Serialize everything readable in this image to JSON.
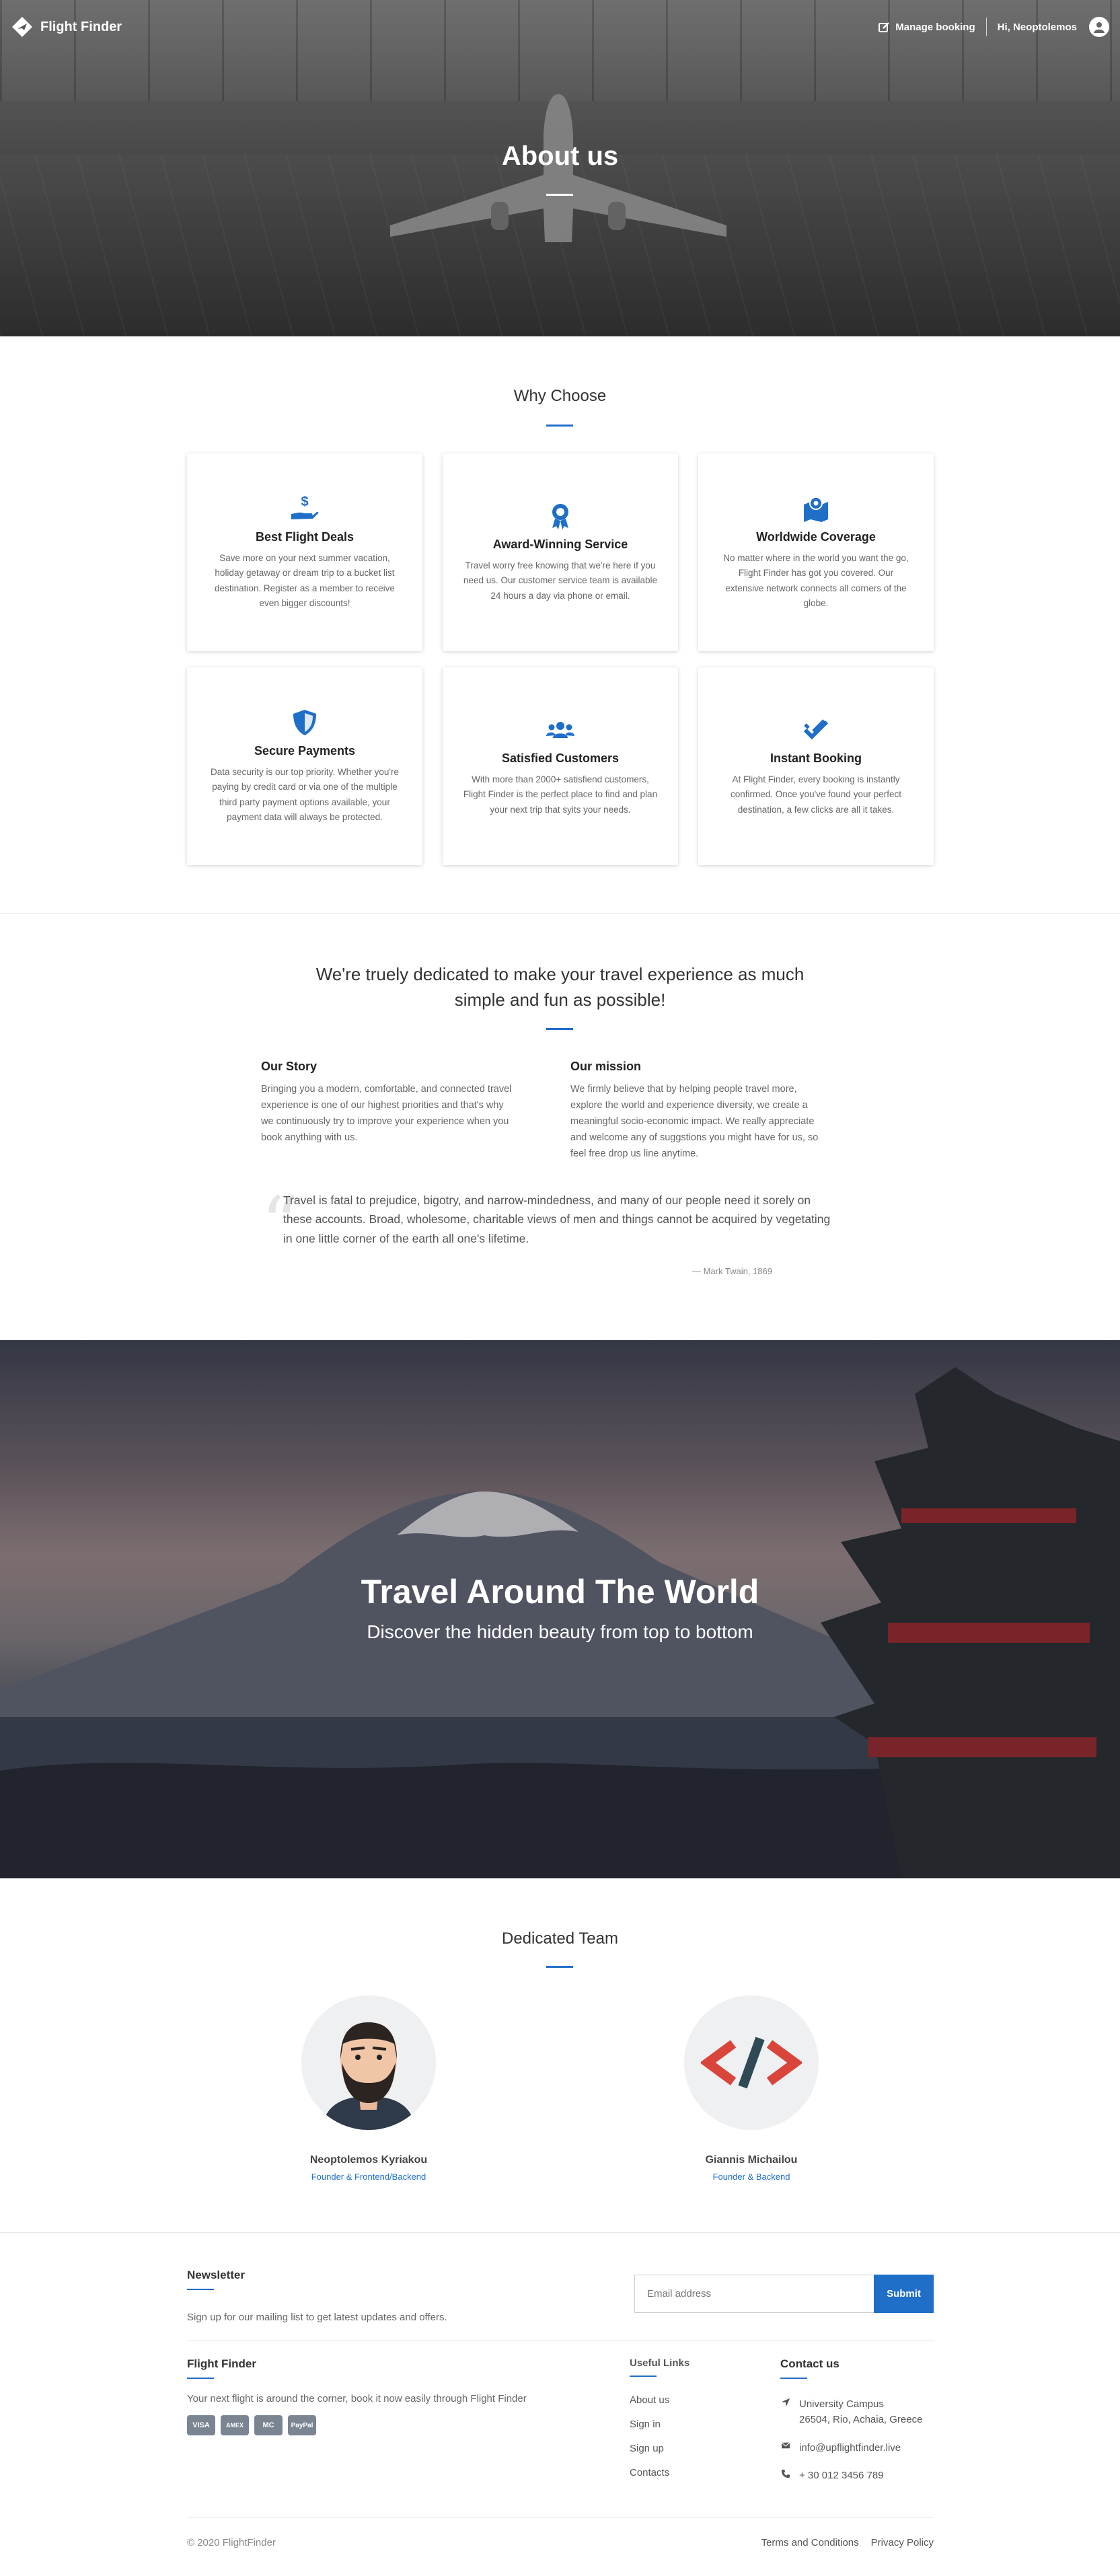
{
  "nav": {
    "brand": "Flight Finder",
    "manage_booking": "Manage booking",
    "greeting": "Hi, Neoptolemos"
  },
  "hero": {
    "title": "About us"
  },
  "why": {
    "title": "Why Choose",
    "cards": [
      {
        "icon": "hand-dollar-icon",
        "title": "Best Flight Deals",
        "text": "Save more on your next summer vacation, holiday getaway or dream trip to a bucket list destination. Register as a member to receive even bigger discounts!"
      },
      {
        "icon": "award-icon",
        "title": "Award-Winning Service",
        "text": "Travel worry free knowing that we're here if you need us. Our customer service team is available 24 hours a day via phone or email."
      },
      {
        "icon": "map-marked-icon",
        "title": "Worldwide Coverage",
        "text": "No matter where in the world you want the go, Flight Finder has got you covered. Our extensive network connects all corners of the globe."
      },
      {
        "icon": "shield-icon",
        "title": "Secure Payments",
        "text": "Data security is our top priority. Whether you're paying by credit card or via one of the multiple third party payment options available, your payment data will always be protected."
      },
      {
        "icon": "users-icon",
        "title": "Satisfied Customers",
        "text": "With more than 2000+ satisfiend customers, Flight Finder is the perfect place to find and plan your next trip that syits your needs."
      },
      {
        "icon": "double-check-icon",
        "title": "Instant Booking",
        "text": "At Flight Finder, every booking is instantly confirmed. Once you've found your perfect destination, a few clicks are all it takes."
      }
    ]
  },
  "mission": {
    "heading_line1": "We're truely dedicated to make your travel experience as much",
    "heading_line2": "simple and fun as possible!",
    "story_title": "Our Story",
    "story_text": "Bringing you a modern, comfortable, and connected travel experience is one of our highest priorities and that's why we continuously try to improve your experience when you book anything with us.",
    "mission_title": "Our mission",
    "mission_text": "We firmly believe that by helping people travel more, explore the world and experience diversity, we create a meaningful socio-economic impact. We really appreciate and welcome any of suggstions you might have for us, so feel free drop us line anytime.",
    "quote": "Travel is fatal to prejudice, bigotry, and narrow-mindedness, and many of our people need it sorely on these accounts. Broad, wholesome, charitable views of men and things cannot be acquired by vegetating in one little corner of the earth all one's lifetime.",
    "cite": "— Mark Twain, 1869"
  },
  "travel": {
    "title": "Travel Around The World",
    "subtitle": "Discover the hidden beauty from top to bottom"
  },
  "team": {
    "title": "Dedicated Team",
    "members": [
      {
        "name": "Neoptolemos Kyriakou",
        "role": "Founder & Frontend/Backend"
      },
      {
        "name": "Giannis Michailou",
        "role": "Founder & Backend"
      }
    ]
  },
  "footer": {
    "newsletter_title": "Newsletter",
    "newsletter_text": "Sign up for our mailing list to get latest updates and offers.",
    "email_placeholder": "Email address",
    "submit": "Submit",
    "about_title": "Flight Finder",
    "about_text": "Your next flight is around the corner, book it now easily through Flight Finder",
    "payment_cards": [
      "VISA",
      "AMEX",
      "MC",
      "PayPal"
    ],
    "links_title": "Useful Links",
    "links": [
      "About us",
      "Sign in",
      "Sign up",
      "Contacts"
    ],
    "contact_title": "Contact us",
    "address_line1": "University Campus",
    "address_line2": "26504, Rio, Achaia, Greece",
    "email": "info@upflightfinder.live",
    "phone": "+ 30 012 3456 789",
    "copyright": "© 2020 FlightFinder",
    "terms": "Terms and Conditions",
    "privacy": "Privacy Policy"
  },
  "colors": {
    "accent": "#1f6ec8"
  }
}
